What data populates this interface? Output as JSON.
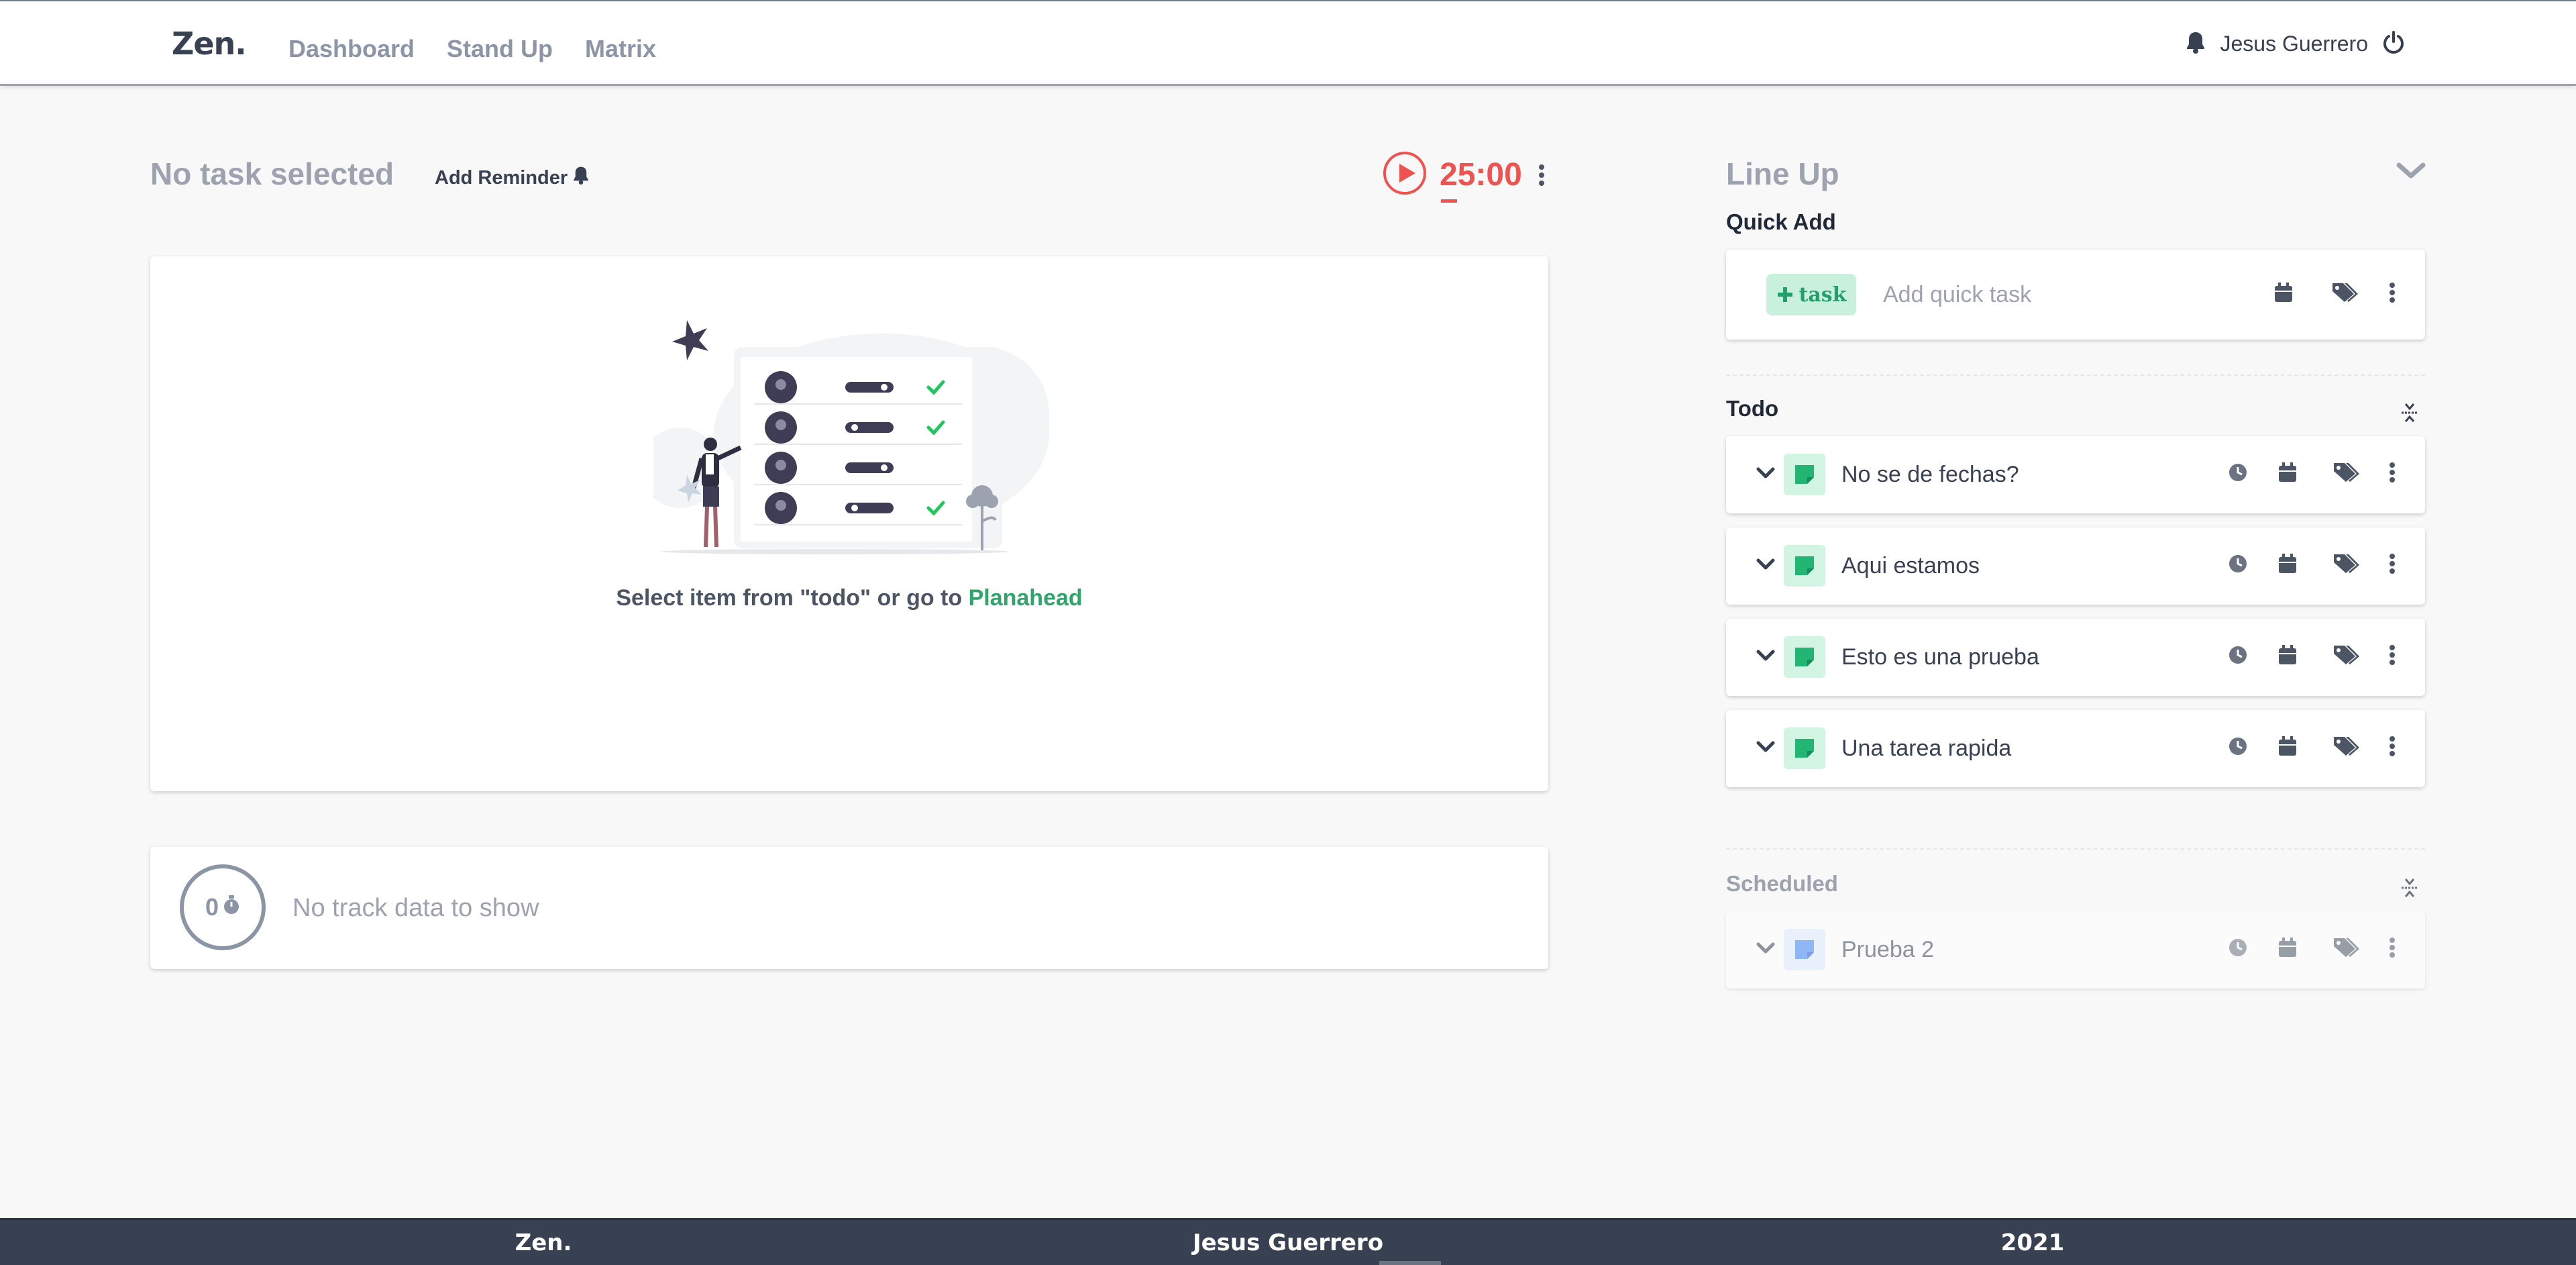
{
  "nav": {
    "brand": "Zen.",
    "links": [
      "Dashboard",
      "Stand Up",
      "Matrix"
    ],
    "user": "Jesus Guerrero"
  },
  "focus": {
    "title": "No task selected",
    "add_reminder": "Add Reminder",
    "timer": "25:00",
    "empty_prefix": "Select item from \"todo\" or go to ",
    "empty_link": "Planahead",
    "track_count": "0",
    "track_text": "No track data to show"
  },
  "lineup": {
    "title": "Line Up",
    "quick_add_label": "Quick Add",
    "task_chip": "task",
    "quick_placeholder": "Add quick task",
    "todo_label": "Todo",
    "todo_items": [
      "No se de fechas?",
      "Aqui estamos",
      "Esto es una prueba",
      "Una tarea rapida"
    ],
    "scheduled_label": "Scheduled",
    "scheduled_items": [
      "Prueba 2"
    ]
  },
  "footer": {
    "brand": "Zen.",
    "author": "Jesus Guerrero",
    "year": "2021"
  },
  "colors": {
    "accent_green": "#2fa56b",
    "timer_red": "#ef5350",
    "footer_bg": "#374151"
  }
}
